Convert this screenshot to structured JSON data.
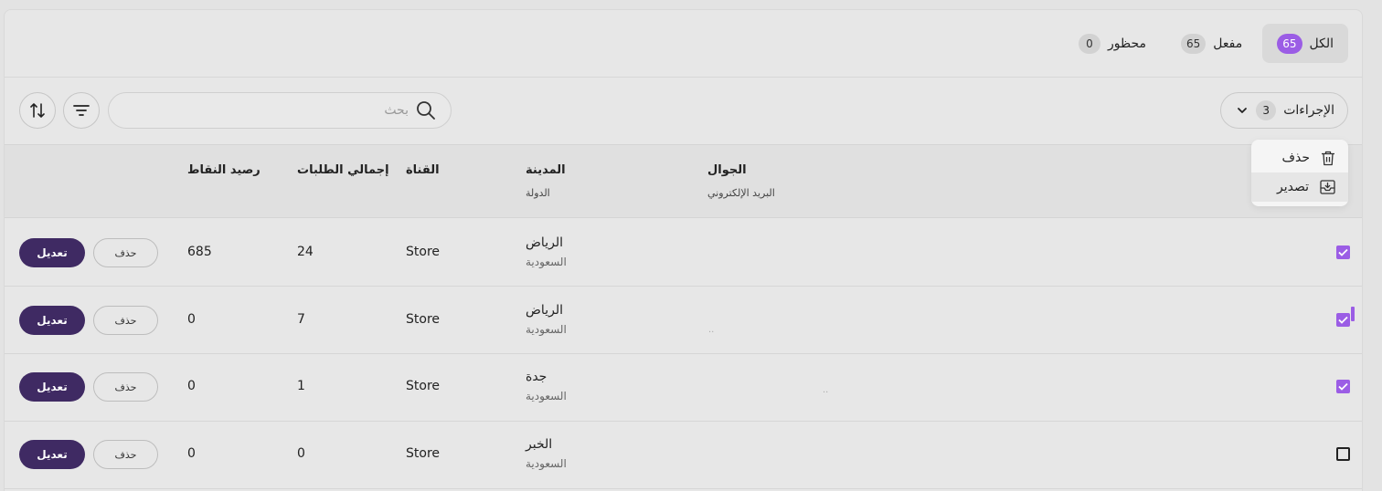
{
  "tabs": [
    {
      "label": "الكل",
      "count": "65"
    },
    {
      "label": "مفعل",
      "count": "65"
    },
    {
      "label": "محظور",
      "count": "0"
    }
  ],
  "toolbar": {
    "actions_label": "الإجراءات",
    "actions_count": "3",
    "search_placeholder": "بحث"
  },
  "menu": {
    "items": [
      {
        "label": "حذف",
        "icon": "trash-icon"
      },
      {
        "label": "تصدير",
        "icon": "export-icon"
      }
    ]
  },
  "table": {
    "headers": {
      "mobile": "الجوال",
      "email": "البريد الإلكتروني",
      "city": "المدينة",
      "country": "الدولة",
      "channel": "القناة",
      "total_orders": "إجمالي الطلبات",
      "points_balance": "رصيد النقاط"
    },
    "rows": [
      {
        "checked": true,
        "city": "الرياض",
        "country": "السعودية",
        "channel": "Store",
        "orders": "24",
        "points": "685",
        "mobile_dots": "",
        "email_dots": "",
        "edit": "تعديل",
        "delete": "حذف"
      },
      {
        "checked": true,
        "city": "الرياض",
        "country": "السعودية",
        "channel": "Store",
        "orders": "7",
        "points": "0",
        "mobile_dots": "",
        "email_dots": "..",
        "edit": "تعديل",
        "delete": "حذف"
      },
      {
        "checked": true,
        "city": "جدة",
        "country": "السعودية",
        "channel": "Store",
        "orders": "1",
        "points": "0",
        "mobile_dots": "..",
        "email_dots": "",
        "edit": "تعديل",
        "delete": "حذف"
      },
      {
        "checked": false,
        "city": "الخبر",
        "country": "السعودية",
        "channel": "Store",
        "orders": "0",
        "points": "0",
        "mobile_dots": "",
        "email_dots": "",
        "edit": "تعديل",
        "delete": "حذف"
      }
    ]
  },
  "colors": {
    "accent": "#9b5de5",
    "primary_button": "#3f2a63"
  }
}
